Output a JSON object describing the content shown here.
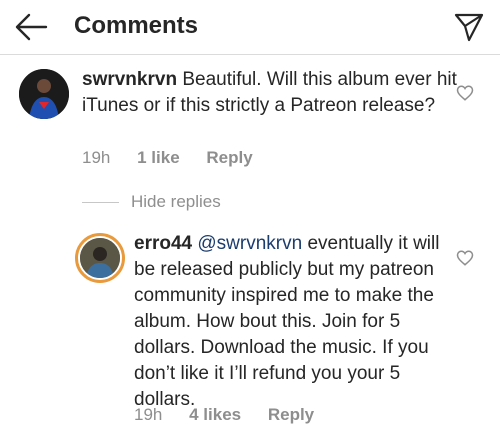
{
  "header": {
    "title": "Comments",
    "back_icon": "arrow-left-icon",
    "share_icon": "paper-plane-icon"
  },
  "comments": [
    {
      "username": "swrvnkrvn",
      "text": "Beautiful. Will this album ever hit iTunes or if this strictly a Patreon release?",
      "time": "19h",
      "likes": "1 like",
      "reply": "Reply"
    }
  ],
  "hide_replies": "Hide replies",
  "replies": [
    {
      "username": "erro44",
      "mention": "@swrvnkrvn",
      "text": "eventually it will be released publicly but my patreon community inspired me to make the album.  How bout this.  Join for 5 dollars.  Download the music.  If you don’t like it I’ll refund you your 5 dollars.",
      "time": "19h",
      "likes": "4 likes",
      "reply": "Reply"
    }
  ],
  "colors": {
    "text": "#262626",
    "secondary": "#8e8e8e",
    "mention": "#1b3d6e",
    "story_ring": "#e89a3c"
  }
}
